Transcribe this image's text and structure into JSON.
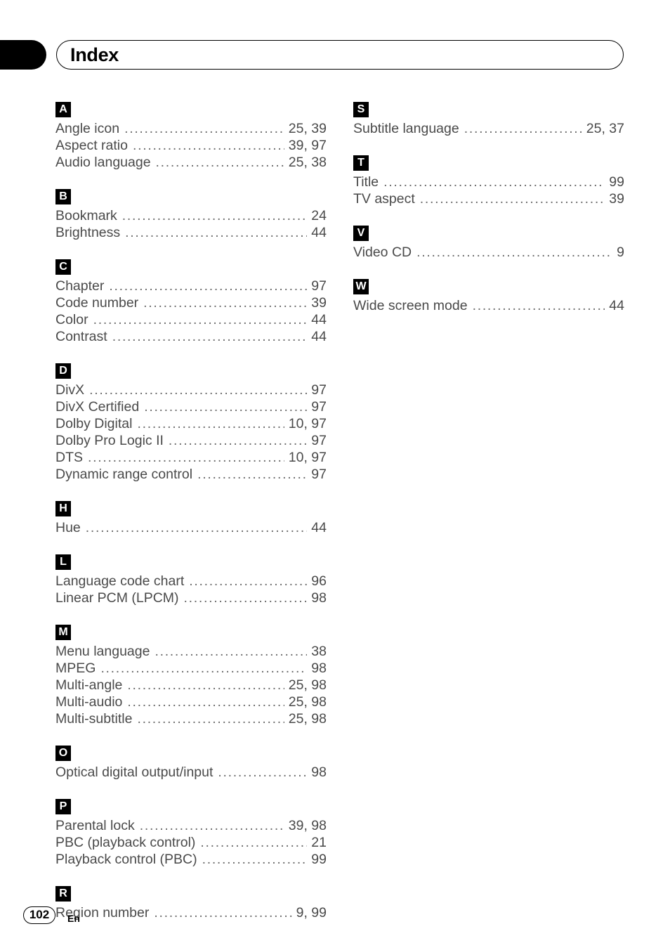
{
  "header": {
    "title": "Index"
  },
  "footer": {
    "page_number": "102",
    "language": "En"
  },
  "columns": [
    {
      "id": "left",
      "sections": [
        {
          "letter": "A",
          "entries": [
            {
              "label": "Angle icon",
              "pages": "25, 39"
            },
            {
              "label": "Aspect ratio",
              "pages": "39, 97"
            },
            {
              "label": "Audio language",
              "pages": "25, 38"
            }
          ]
        },
        {
          "letter": "B",
          "entries": [
            {
              "label": "Bookmark",
              "pages": "24"
            },
            {
              "label": "Brightness",
              "pages": "44"
            }
          ]
        },
        {
          "letter": "C",
          "entries": [
            {
              "label": "Chapter",
              "pages": "97"
            },
            {
              "label": "Code number",
              "pages": "39"
            },
            {
              "label": "Color",
              "pages": "44"
            },
            {
              "label": "Contrast",
              "pages": "44"
            }
          ]
        },
        {
          "letter": "D",
          "entries": [
            {
              "label": "DivX",
              "pages": "97"
            },
            {
              "label": "DivX Certified",
              "pages": "97"
            },
            {
              "label": "Dolby Digital",
              "pages": "10, 97"
            },
            {
              "label": "Dolby Pro Logic II",
              "pages": "97"
            },
            {
              "label": "DTS",
              "pages": "10, 97"
            },
            {
              "label": "Dynamic range control",
              "pages": "97"
            }
          ]
        },
        {
          "letter": "H",
          "entries": [
            {
              "label": "Hue",
              "pages": "44"
            }
          ]
        },
        {
          "letter": "L",
          "entries": [
            {
              "label": "Language code chart",
              "pages": "96"
            },
            {
              "label": "Linear PCM (LPCM)",
              "pages": "98"
            }
          ]
        },
        {
          "letter": "M",
          "entries": [
            {
              "label": "Menu language",
              "pages": "38"
            },
            {
              "label": "MPEG",
              "pages": "98"
            },
            {
              "label": "Multi-angle",
              "pages": "25, 98"
            },
            {
              "label": "Multi-audio",
              "pages": "25, 98"
            },
            {
              "label": "Multi-subtitle",
              "pages": "25, 98"
            }
          ]
        },
        {
          "letter": "O",
          "entries": [
            {
              "label": "Optical digital output/input",
              "pages": "98"
            }
          ]
        },
        {
          "letter": "P",
          "entries": [
            {
              "label": "Parental lock",
              "pages": "39, 98"
            },
            {
              "label": "PBC (playback control)",
              "pages": "21"
            },
            {
              "label": "Playback control (PBC)",
              "pages": "99"
            }
          ]
        },
        {
          "letter": "R",
          "entries": [
            {
              "label": "Region number",
              "pages": "9, 99"
            }
          ]
        }
      ]
    },
    {
      "id": "right",
      "sections": [
        {
          "letter": "S",
          "entries": [
            {
              "label": "Subtitle language",
              "pages": "25, 37"
            }
          ]
        },
        {
          "letter": "T",
          "entries": [
            {
              "label": "Title",
              "pages": "99"
            },
            {
              "label": "TV aspect",
              "pages": "39"
            }
          ]
        },
        {
          "letter": "V",
          "entries": [
            {
              "label": "Video CD",
              "pages": "9"
            }
          ]
        },
        {
          "letter": "W",
          "entries": [
            {
              "label": "Wide screen mode",
              "pages": "44"
            }
          ]
        }
      ]
    }
  ]
}
